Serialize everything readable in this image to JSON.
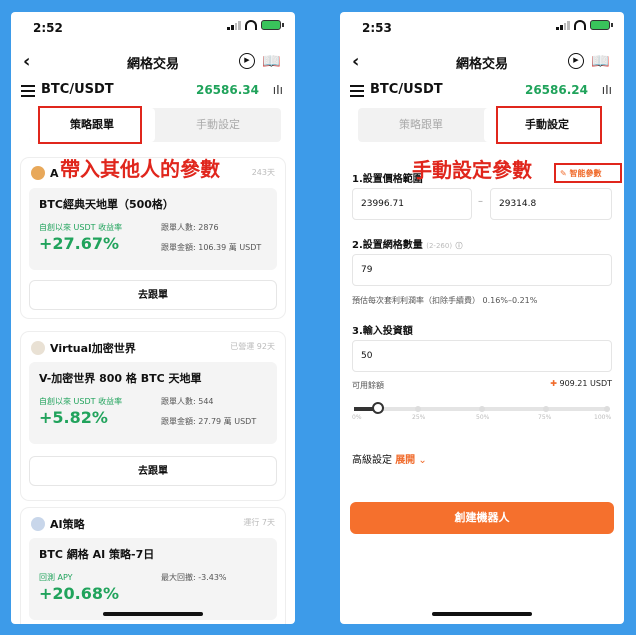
{
  "left": {
    "time": "2:52",
    "title": "網格交易",
    "pair": "BTC/USDT",
    "price": "26586.34",
    "tabs": [
      "策略跟單",
      "手動設定"
    ],
    "annotation": "帶入其他人的參數",
    "cards": [
      {
        "author": "A",
        "meta": "243天",
        "name": "BTC經典天地單（500格）",
        "roi_label": "自創以來 USDT 收益率",
        "roi": "+27.67%",
        "followers": "跟單人數: 2876",
        "amount": "跟單金額: 106.39 萬 USDT",
        "button": "去跟單"
      },
      {
        "author": "Virtual加密世界",
        "meta": "已營運 92天",
        "name": "V-加密世界 800 格 BTC 天地單",
        "roi_label": "自創以來 USDT 收益率",
        "roi": "+5.82%",
        "followers": "跟單人數: 544",
        "amount": "跟單金額: 27.79 萬 USDT",
        "button": "去跟單"
      },
      {
        "author": "AI策略",
        "meta": "運行 7天",
        "name": "BTC 網格 AI 策略-7日",
        "roi_label": "回測 APY",
        "roi": "+20.68%",
        "followers": "最大回撤: -3.43%"
      }
    ]
  },
  "right": {
    "time": "2:53",
    "title": "網格交易",
    "pair": "BTC/USDT",
    "price": "26586.24",
    "tabs": [
      "策略跟單",
      "手動設定"
    ],
    "annotation": "手動設定參數",
    "smart_param": "智能參數",
    "sec1": "1.設置價格範圍",
    "low": "23996.71",
    "dash": "–",
    "high": "29314.8",
    "sec2": "2.設置網格數量",
    "sec2_hint": "(2-260)",
    "grid_count": "79",
    "profit_note": "預估每次套利利潤率（扣除手續費） 0.16%–0.21%",
    "sec3": "3.輸入投資額",
    "invest": "50",
    "avail_label": "可用餘額",
    "avail": "909.21 USDT",
    "ticks": [
      "0%",
      "25%",
      "50%",
      "75%",
      "100%"
    ],
    "adv_label": "高級設定",
    "adv_toggle": "展開",
    "cta": "創建機器人"
  }
}
